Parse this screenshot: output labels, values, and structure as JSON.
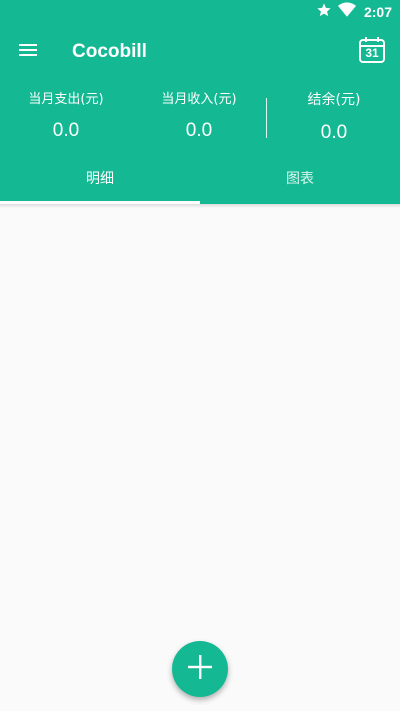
{
  "status_bar": {
    "time": "2:07",
    "icons": [
      "star-icon",
      "wifi-icon"
    ]
  },
  "toolbar": {
    "title": "Cocobill",
    "menu_icon": "hamburger-menu-icon",
    "calendar_icon": "calendar-icon",
    "calendar_day": "31"
  },
  "summary": {
    "expense_label": "当月支出(元)",
    "expense_value": "0.0",
    "income_label": "当月收入(元)",
    "income_value": "0.0",
    "balance_label": "结余(元)",
    "balance_value": "0.0"
  },
  "tabs": [
    {
      "label": "明细",
      "selected": true
    },
    {
      "label": "图表",
      "selected": false
    }
  ],
  "fab": {
    "icon": "plus-icon"
  },
  "colors": {
    "primary": "#14b993",
    "background": "#fafafa",
    "on_primary": "#ffffff"
  }
}
